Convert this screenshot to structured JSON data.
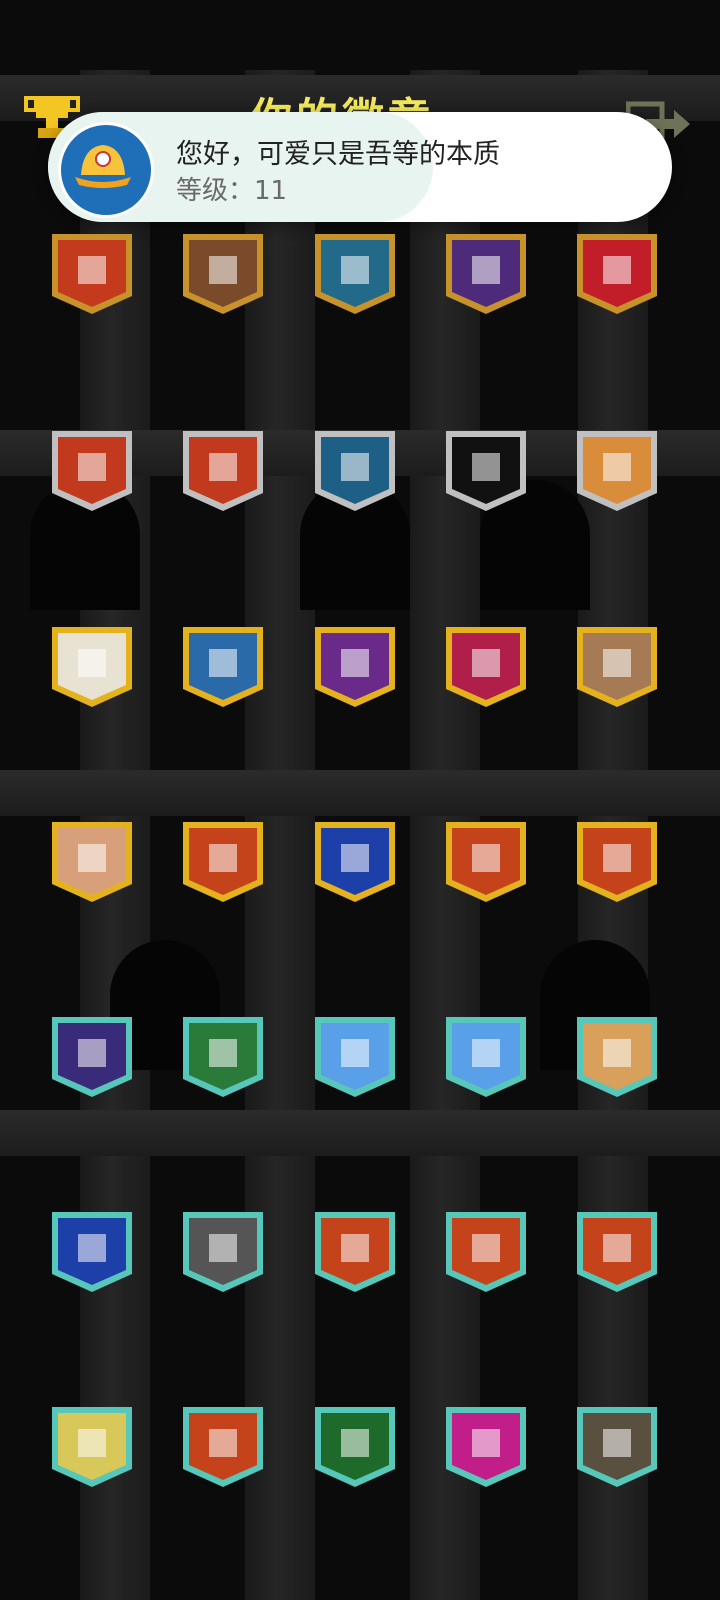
{
  "screen": {
    "title": "你的徽章",
    "trophy_icon": "trophy-icon",
    "exit_icon": "exit-icon"
  },
  "notification": {
    "title": "您好，可爱只是吾等的本质",
    "subtitle": "等级：11",
    "avatar_icon": "baseball-cap-icon"
  },
  "badges": [
    [
      "elder-portrait-badge",
      "boy-portrait-badge",
      "blonde-portrait-badge",
      "girl-portrait-badge",
      "sunglasses-badge"
    ],
    [
      "cross-silver-badge",
      "plus-silver-badge",
      "fish-badge",
      "skull-badge",
      "briefcase-badge"
    ],
    [
      "speech-bubble-badge",
      "sword-badge",
      "gold-coin-badge",
      "padlock-badge",
      "cookie-badge"
    ],
    [
      "pot-badge",
      "plus-gold-badge",
      "rainbow-gem-badge",
      "dark-blob-badge",
      "hat-badge"
    ],
    [
      "up-arrow-badge",
      "pawn-badge",
      "cloud-badge",
      "grave-cross-badge",
      "card-badge"
    ],
    [
      "rainbow-orb-badge",
      "phone-badge",
      "plus-teal-badge",
      "diamond-badge",
      "crown-badge"
    ],
    [
      "chest-badge",
      "rainbow-orb-2-badge",
      "bar-chart-badge",
      "trophy-badge",
      "locked-chest-badge"
    ]
  ]
}
